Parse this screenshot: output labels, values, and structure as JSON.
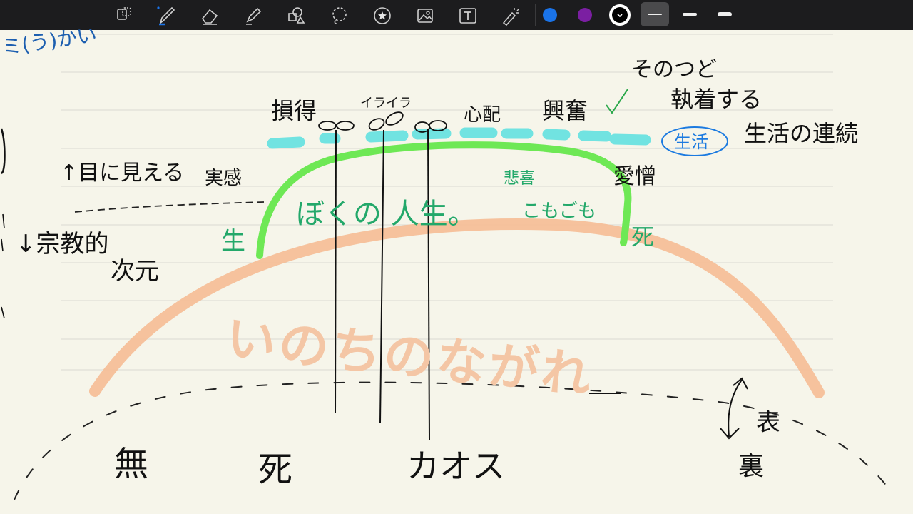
{
  "toolbar": {
    "tools": [
      "lasso-select-icon",
      "pen-icon",
      "eraser-icon",
      "highlighter-icon",
      "shapes-icon",
      "lasso-icon",
      "sticker-icon",
      "image-icon",
      "text-icon",
      "laser-pointer-icon"
    ],
    "active_tool": "pen-icon",
    "colors": [
      "#1a73e8",
      "#7b1fa2",
      "#000000"
    ],
    "selected_color": "#000000",
    "stroke_widths": [
      "thin",
      "medium",
      "thick"
    ],
    "selected_stroke": "thin"
  },
  "notes": {
    "top_cut": "ミ(う)かい",
    "sonotsudo": "そのつど",
    "shuuchaku": "執着する",
    "seikatsu": "生活の連続",
    "seikatsu_circled": "生活",
    "sontoku": "損得",
    "iraira": "イライラ",
    "shinpai": "心配",
    "koufun": "興奮",
    "aizou": "愛憎",
    "mieru": "↑目に見える",
    "jikkan": "実感",
    "shuukyou": "↓宗教的",
    "jigen": "次元",
    "sei_left": "生",
    "boku_no_jinsei": "ぼくの 人生。",
    "hiki": "悲喜",
    "komogomo": "こもごも",
    "shi_right": "死",
    "inochi_no_nagare": "いのちのながれ",
    "mu": "無",
    "shi_bottom": "死",
    "chaos": "カオス",
    "omote": "表",
    "ura": "裏"
  }
}
